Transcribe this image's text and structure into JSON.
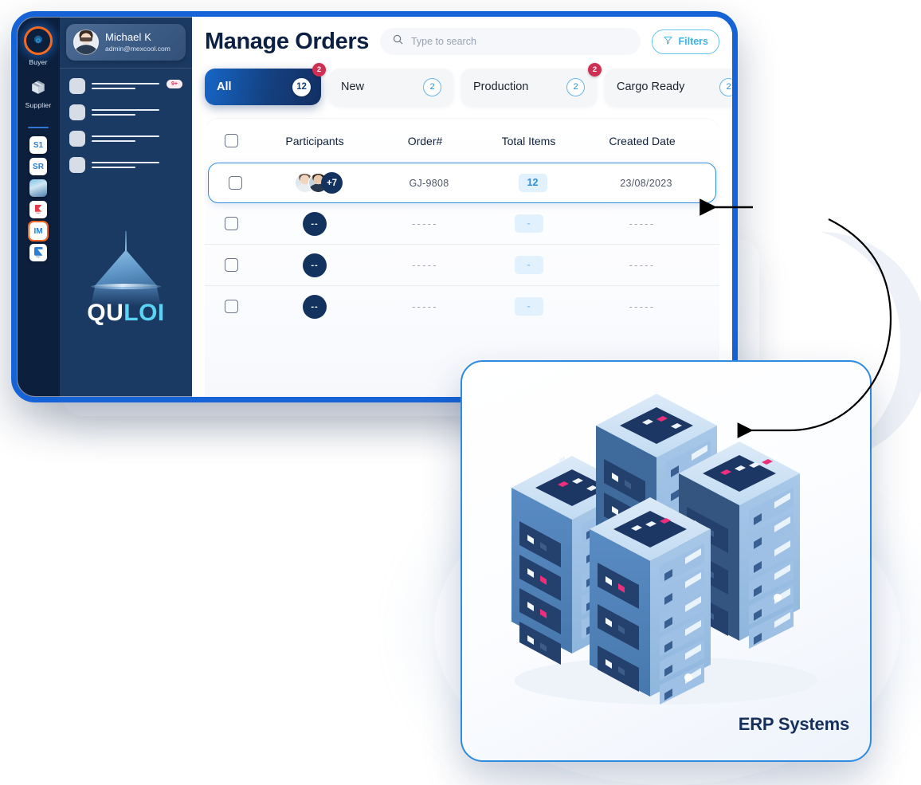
{
  "rail": {
    "modes": [
      {
        "label": "Buyer",
        "icon": "gear-icon",
        "active": true
      },
      {
        "label": "Supplier",
        "icon": "box-icon",
        "active": false
      }
    ],
    "apps": [
      {
        "label": "S1",
        "kind": "text"
      },
      {
        "label": "SR",
        "kind": "text"
      },
      {
        "label": "",
        "kind": "photo"
      },
      {
        "label": "",
        "kind": "redlogo"
      },
      {
        "label": "IM",
        "kind": "text",
        "selected": true
      },
      {
        "label": "",
        "kind": "bluelogo"
      }
    ]
  },
  "nav": {
    "profile": {
      "name": "Michael K",
      "email": "admin@mexcool.com",
      "avatar": "user-avatar"
    },
    "skeleton_items": [
      {
        "badge": "9+"
      },
      {
        "badge": ""
      },
      {
        "badge": ""
      },
      {
        "badge": ""
      }
    ],
    "brand": {
      "part1": "QU",
      "part2": "LOI"
    }
  },
  "header": {
    "title": "Manage Orders",
    "search_placeholder": "Type to search",
    "search_value": "",
    "filters_label": "Filters"
  },
  "tabs": [
    {
      "label": "All",
      "count": "12",
      "alert": "2",
      "active": true
    },
    {
      "label": "New",
      "count": "2",
      "alert": "",
      "active": false
    },
    {
      "label": "Production",
      "count": "2",
      "alert": "2",
      "active": false
    },
    {
      "label": "Cargo Ready",
      "count": "2",
      "alert": "",
      "active": false
    }
  ],
  "table": {
    "columns": [
      "Participants",
      "Order#",
      "Total Items",
      "Created Date"
    ],
    "rows": [
      {
        "participants_extra": "+7",
        "order": "GJ-9808",
        "total_items": "12",
        "created_date": "23/08/2023",
        "selected": true
      },
      {
        "participants_extra": "--",
        "order": "-----",
        "total_items": "-",
        "created_date": "-----",
        "selected": false
      },
      {
        "participants_extra": "--",
        "order": "-----",
        "total_items": "-",
        "created_date": "-----",
        "selected": false
      },
      {
        "participants_extra": "--",
        "order": "-----",
        "total_items": "-",
        "created_date": "-----",
        "selected": false
      }
    ]
  },
  "erp": {
    "label": "ERP Systems",
    "illustration": "server-racks-isometric"
  },
  "colors": {
    "frame_blue": "#1563d6",
    "nav_navy": "#1b3a63",
    "rail_navy": "#0c1f3d",
    "accent_blue": "#2a8fd8",
    "alert_red": "#cf2f53",
    "brand_cyan": "#5bd3f5",
    "orange_ring": "#f26a21"
  }
}
